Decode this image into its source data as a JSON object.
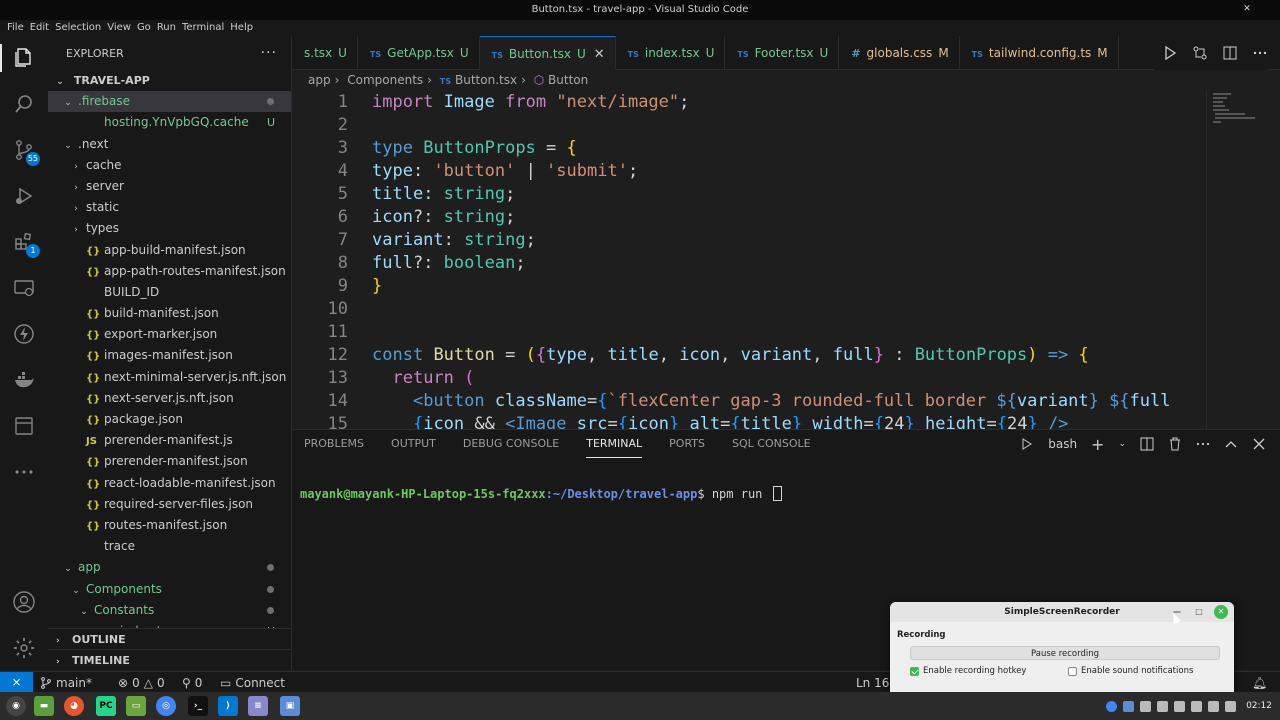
{
  "window": {
    "title": "Button.tsx - travel-app - Visual Studio Code",
    "close_glyph": "✕"
  },
  "menu": [
    "File",
    "Edit",
    "Selection",
    "View",
    "Go",
    "Run",
    "Terminal",
    "Help"
  ],
  "activity": {
    "scm_badge": "55",
    "extensions_badge": "1"
  },
  "sidebar": {
    "title": "EXPLORER",
    "more": "···",
    "root": "TRAVEL-APP",
    "items": [
      {
        "name": ".firebase",
        "kind": "folder-open",
        "depth": 1,
        "selected": true,
        "dot": true,
        "color": "green"
      },
      {
        "name": "hosting.YnVpbGQ.cache",
        "kind": "file",
        "depth": 2,
        "status": "U",
        "color": "green"
      },
      {
        "name": ".next",
        "kind": "folder-open",
        "depth": 1
      },
      {
        "name": "cache",
        "kind": "folder",
        "depth": 2
      },
      {
        "name": "server",
        "kind": "folder",
        "depth": 2
      },
      {
        "name": "static",
        "kind": "folder",
        "depth": 2
      },
      {
        "name": "types",
        "kind": "folder",
        "depth": 2
      },
      {
        "name": "app-build-manifest.json",
        "kind": "json",
        "depth": 2
      },
      {
        "name": "app-path-routes-manifest.json",
        "kind": "json",
        "depth": 2
      },
      {
        "name": "BUILD_ID",
        "kind": "file",
        "depth": 2
      },
      {
        "name": "build-manifest.json",
        "kind": "json",
        "depth": 2
      },
      {
        "name": "export-marker.json",
        "kind": "json",
        "depth": 2
      },
      {
        "name": "images-manifest.json",
        "kind": "json",
        "depth": 2
      },
      {
        "name": "next-minimal-server.js.nft.json",
        "kind": "json",
        "depth": 2
      },
      {
        "name": "next-server.js.nft.json",
        "kind": "json",
        "depth": 2
      },
      {
        "name": "package.json",
        "kind": "json",
        "depth": 2
      },
      {
        "name": "prerender-manifest.js",
        "kind": "js",
        "depth": 2
      },
      {
        "name": "prerender-manifest.json",
        "kind": "json",
        "depth": 2
      },
      {
        "name": "react-loadable-manifest.json",
        "kind": "json",
        "depth": 2
      },
      {
        "name": "required-server-files.json",
        "kind": "json",
        "depth": 2
      },
      {
        "name": "routes-manifest.json",
        "kind": "json",
        "depth": 2
      },
      {
        "name": "trace",
        "kind": "file",
        "depth": 2
      },
      {
        "name": "app",
        "kind": "folder-open",
        "depth": 1,
        "dot": true,
        "color": "green"
      },
      {
        "name": "Components",
        "kind": "folder-open",
        "depth": 2,
        "dot": true,
        "color": "green"
      },
      {
        "name": "Constants",
        "kind": "folder-open",
        "depth": 3,
        "dot": true,
        "color": "green"
      },
      {
        "name": "index.tsx",
        "kind": "ts",
        "depth": 4,
        "status": "U",
        "color": "green"
      }
    ],
    "outline": "OUTLINE",
    "timeline": "TIMELINE"
  },
  "tabs": [
    {
      "label": "s.tsx",
      "status": "U",
      "icon": "",
      "state": "untracked"
    },
    {
      "label": "GetApp.tsx",
      "status": "U",
      "icon": "TS",
      "state": "untracked"
    },
    {
      "label": "Button.tsx",
      "status": "U",
      "icon": "TS",
      "state": "untracked",
      "active": true
    },
    {
      "label": "index.tsx",
      "status": "U",
      "icon": "TS",
      "state": "untracked"
    },
    {
      "label": "Footer.tsx",
      "status": "U",
      "icon": "TS",
      "state": "untracked"
    },
    {
      "label": "globals.css",
      "status": "M",
      "icon": "#",
      "state": "modified"
    },
    {
      "label": "tailwind.config.ts",
      "status": "M",
      "icon": "TS",
      "state": "modified"
    }
  ],
  "breadcrumb": {
    "parts": [
      "app",
      "Components",
      "Button.tsx",
      "Button"
    ],
    "ts_icon": "TS"
  },
  "editor": {
    "lines": [
      {
        "n": "1",
        "html": "<span class='kw2'>import</span> <span class='var'>Image</span> <span class='kw2'>from</span> <span class='str'>\"next/image\"</span>;"
      },
      {
        "n": "2",
        "html": ""
      },
      {
        "n": "3",
        "html": "<span class='kw'>type</span> <span class='typ'>ButtonProps</span> = <span class='br1'>{</span>"
      },
      {
        "n": "4",
        "html": "<span class='var'>type</span>: <span class='str'>'button'</span> | <span class='str'>'submit'</span>;"
      },
      {
        "n": "5",
        "html": "<span class='var'>title</span>: <span class='typ'>string</span>;"
      },
      {
        "n": "6",
        "html": "<span class='var'>icon</span>?: <span class='typ'>string</span>;"
      },
      {
        "n": "7",
        "html": "<span class='var'>variant</span>: <span class='typ'>string</span>;"
      },
      {
        "n": "8",
        "html": "<span class='var'>full</span>?: <span class='typ'>boolean</span>;"
      },
      {
        "n": "9",
        "html": "<span class='br1'>}</span>"
      },
      {
        "n": "10",
        "html": ""
      },
      {
        "n": "11",
        "html": ""
      },
      {
        "n": "12",
        "html": "<span class='kw'>const</span> <span class='fn'>Button</span> = <span class='br1'>(</span><span class='br2'>{</span><span class='var'>type</span>, <span class='var'>title</span>, <span class='var'>icon</span>, <span class='var'>variant</span>, <span class='var'>full</span><span class='br2'>}</span> : <span class='typ'>ButtonProps</span><span class='br1'>)</span> <span class='kw'>=&gt;</span> <span class='br1'>{</span>"
      },
      {
        "n": "13",
        "html": "  <span class='kw2'>return</span> <span class='br2'>(</span>"
      },
      {
        "n": "14",
        "html": "    <span class='kw'>&lt;button</span> <span class='var'>className</span>=<span class='br3'>{</span><span class='str'>`flexCenter gap-3 rounded-full border </span><span class='kw'>${</span><span class='var'>variant</span><span class='kw'>}</span> <span class='kw'>${</span><span class='var'>full</span>"
      },
      {
        "n": "15",
        "html": "    <span class='br3'>{</span><span class='var'>icon</span> &amp;&amp; <span class='kw'>&lt;Image</span> <span class='var'>src</span>=<span class='br3'>{</span><span class='var'>icon</span><span class='br3'>}</span> <span class='var'>alt</span>=<span class='br3'>{</span><span class='var'>title</span><span class='br3'>}</span> <span class='var'>width</span>=<span class='br3'>{</span>24<span class='br3'>}</span> <span class='var'>height</span>=<span class='br3'>{</span>24<span class='br3'>}</span> <span class='kw'>/&gt;</span>"
      }
    ]
  },
  "panel": {
    "tabs": [
      "PROBLEMS",
      "OUTPUT",
      "DEBUG CONSOLE",
      "TERMINAL",
      "PORTS",
      "SQL CONSOLE"
    ],
    "active_tab": "TERMINAL",
    "shell": "bash",
    "terminal": {
      "user": "mayank@mayank-HP-Laptop-15s-fq2xxx",
      "path": ":~/Desktop/travel-app",
      "prompt": "$",
      "command": " npm run "
    }
  },
  "statusbar": {
    "branch": "main*",
    "errors": "0",
    "warnings": "0",
    "ports": "0",
    "connect": "Connect",
    "cursor": "Ln 16,"
  },
  "recorder": {
    "title": "SimpleScreenRecorder",
    "section": "Recording",
    "pause_label": "Pause recording",
    "hotkey_label": "Enable recording hotkey",
    "sound_label": "Enable sound notifications"
  },
  "taskbar": {
    "clock": "02:12"
  },
  "colors": {
    "accent": "#0078d4",
    "untracked": "#73c991",
    "modified": "#e2c08d",
    "background": "#1e1e1e"
  }
}
